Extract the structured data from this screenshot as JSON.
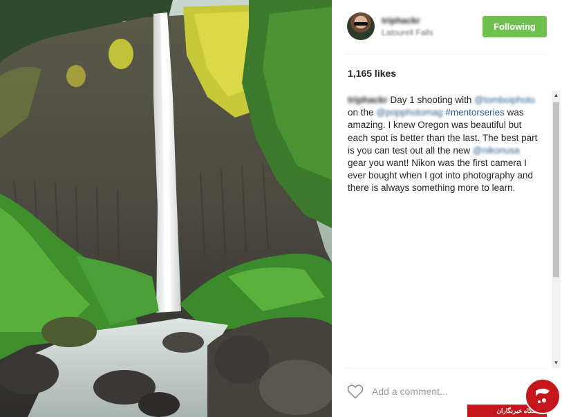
{
  "header": {
    "username": "triphackr",
    "location": "Latourell Falls",
    "follow_label": "Following",
    "colors": {
      "follow_bg": "#70c050"
    }
  },
  "likes": {
    "text": "1,165 likes"
  },
  "caption": {
    "author": "triphackr",
    "part1": " Day 1 shooting with ",
    "mention1": "@tomboiphoto",
    "part2": " on the ",
    "mention2": "@popphotomag",
    "hashtag": "#mentorseries",
    "part3": " was amazing. I knew Oregon was beautiful but each spot is better than the last. The best part is you can test out all the new ",
    "mention3": "@nikonusa",
    "part4": " gear you want! Nikon was the first camera I ever bought when I got into photography and there is always something more to learn."
  },
  "scrollbar": {
    "up_icon": "▲",
    "down_icon": "▼"
  },
  "comment": {
    "placeholder": "Add a comment..."
  },
  "watermark": {
    "text": "باشگاه خبرنگاران"
  },
  "icons": {
    "heart": "heart-outline-icon",
    "logo": "yjc-logo-icon"
  }
}
